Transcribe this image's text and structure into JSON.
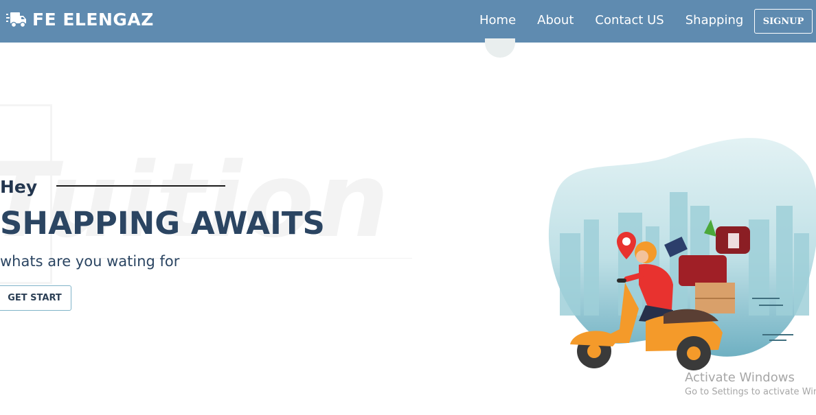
{
  "brand": {
    "name": "FE ELENGAZ",
    "icon": "delivery-truck-icon"
  },
  "nav": {
    "links": [
      "Home",
      "About",
      "Contact US",
      "Shapping"
    ],
    "signup_label": "SIGNUP"
  },
  "hero": {
    "greeting": "Hey",
    "headline": "SHAPPING AWAITS",
    "subline": "whats are you wating for",
    "cta_label": "GET START",
    "watermark_text": "Tuition",
    "illustration": "delivery-scooter-rider-illustration"
  },
  "os_watermark": {
    "title": "Activate Windows",
    "subtitle": "Go to Settings to activate Windows."
  },
  "colors": {
    "navbar": "#5f8bb0",
    "heading_text": "#2b4562",
    "cta_border": "#7fb3c8",
    "blob": "#b9dde3",
    "scooter": "#f49a2a",
    "rider_shirt": "#e8322f"
  }
}
